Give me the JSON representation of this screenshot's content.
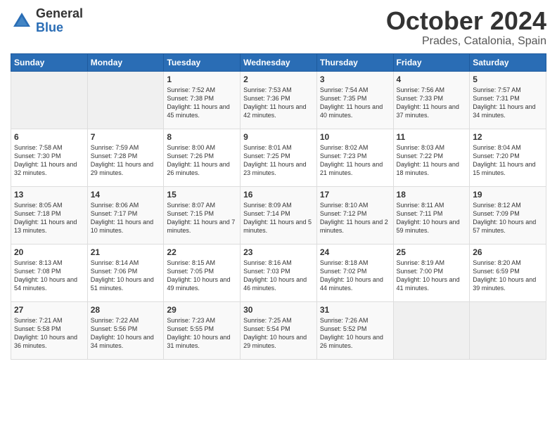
{
  "header": {
    "logo_general": "General",
    "logo_blue": "Blue",
    "month": "October 2024",
    "location": "Prades, Catalonia, Spain"
  },
  "days_of_week": [
    "Sunday",
    "Monday",
    "Tuesday",
    "Wednesday",
    "Thursday",
    "Friday",
    "Saturday"
  ],
  "weeks": [
    [
      {
        "day": "",
        "info": ""
      },
      {
        "day": "",
        "info": ""
      },
      {
        "day": "1",
        "info": "Sunrise: 7:52 AM\nSunset: 7:38 PM\nDaylight: 11 hours and 45 minutes."
      },
      {
        "day": "2",
        "info": "Sunrise: 7:53 AM\nSunset: 7:36 PM\nDaylight: 11 hours and 42 minutes."
      },
      {
        "day": "3",
        "info": "Sunrise: 7:54 AM\nSunset: 7:35 PM\nDaylight: 11 hours and 40 minutes."
      },
      {
        "day": "4",
        "info": "Sunrise: 7:56 AM\nSunset: 7:33 PM\nDaylight: 11 hours and 37 minutes."
      },
      {
        "day": "5",
        "info": "Sunrise: 7:57 AM\nSunset: 7:31 PM\nDaylight: 11 hours and 34 minutes."
      }
    ],
    [
      {
        "day": "6",
        "info": "Sunrise: 7:58 AM\nSunset: 7:30 PM\nDaylight: 11 hours and 32 minutes."
      },
      {
        "day": "7",
        "info": "Sunrise: 7:59 AM\nSunset: 7:28 PM\nDaylight: 11 hours and 29 minutes."
      },
      {
        "day": "8",
        "info": "Sunrise: 8:00 AM\nSunset: 7:26 PM\nDaylight: 11 hours and 26 minutes."
      },
      {
        "day": "9",
        "info": "Sunrise: 8:01 AM\nSunset: 7:25 PM\nDaylight: 11 hours and 23 minutes."
      },
      {
        "day": "10",
        "info": "Sunrise: 8:02 AM\nSunset: 7:23 PM\nDaylight: 11 hours and 21 minutes."
      },
      {
        "day": "11",
        "info": "Sunrise: 8:03 AM\nSunset: 7:22 PM\nDaylight: 11 hours and 18 minutes."
      },
      {
        "day": "12",
        "info": "Sunrise: 8:04 AM\nSunset: 7:20 PM\nDaylight: 11 hours and 15 minutes."
      }
    ],
    [
      {
        "day": "13",
        "info": "Sunrise: 8:05 AM\nSunset: 7:18 PM\nDaylight: 11 hours and 13 minutes."
      },
      {
        "day": "14",
        "info": "Sunrise: 8:06 AM\nSunset: 7:17 PM\nDaylight: 11 hours and 10 minutes."
      },
      {
        "day": "15",
        "info": "Sunrise: 8:07 AM\nSunset: 7:15 PM\nDaylight: 11 hours and 7 minutes."
      },
      {
        "day": "16",
        "info": "Sunrise: 8:09 AM\nSunset: 7:14 PM\nDaylight: 11 hours and 5 minutes."
      },
      {
        "day": "17",
        "info": "Sunrise: 8:10 AM\nSunset: 7:12 PM\nDaylight: 11 hours and 2 minutes."
      },
      {
        "day": "18",
        "info": "Sunrise: 8:11 AM\nSunset: 7:11 PM\nDaylight: 10 hours and 59 minutes."
      },
      {
        "day": "19",
        "info": "Sunrise: 8:12 AM\nSunset: 7:09 PM\nDaylight: 10 hours and 57 minutes."
      }
    ],
    [
      {
        "day": "20",
        "info": "Sunrise: 8:13 AM\nSunset: 7:08 PM\nDaylight: 10 hours and 54 minutes."
      },
      {
        "day": "21",
        "info": "Sunrise: 8:14 AM\nSunset: 7:06 PM\nDaylight: 10 hours and 51 minutes."
      },
      {
        "day": "22",
        "info": "Sunrise: 8:15 AM\nSunset: 7:05 PM\nDaylight: 10 hours and 49 minutes."
      },
      {
        "day": "23",
        "info": "Sunrise: 8:16 AM\nSunset: 7:03 PM\nDaylight: 10 hours and 46 minutes."
      },
      {
        "day": "24",
        "info": "Sunrise: 8:18 AM\nSunset: 7:02 PM\nDaylight: 10 hours and 44 minutes."
      },
      {
        "day": "25",
        "info": "Sunrise: 8:19 AM\nSunset: 7:00 PM\nDaylight: 10 hours and 41 minutes."
      },
      {
        "day": "26",
        "info": "Sunrise: 8:20 AM\nSunset: 6:59 PM\nDaylight: 10 hours and 39 minutes."
      }
    ],
    [
      {
        "day": "27",
        "info": "Sunrise: 7:21 AM\nSunset: 5:58 PM\nDaylight: 10 hours and 36 minutes."
      },
      {
        "day": "28",
        "info": "Sunrise: 7:22 AM\nSunset: 5:56 PM\nDaylight: 10 hours and 34 minutes."
      },
      {
        "day": "29",
        "info": "Sunrise: 7:23 AM\nSunset: 5:55 PM\nDaylight: 10 hours and 31 minutes."
      },
      {
        "day": "30",
        "info": "Sunrise: 7:25 AM\nSunset: 5:54 PM\nDaylight: 10 hours and 29 minutes."
      },
      {
        "day": "31",
        "info": "Sunrise: 7:26 AM\nSunset: 5:52 PM\nDaylight: 10 hours and 26 minutes."
      },
      {
        "day": "",
        "info": ""
      },
      {
        "day": "",
        "info": ""
      }
    ]
  ]
}
